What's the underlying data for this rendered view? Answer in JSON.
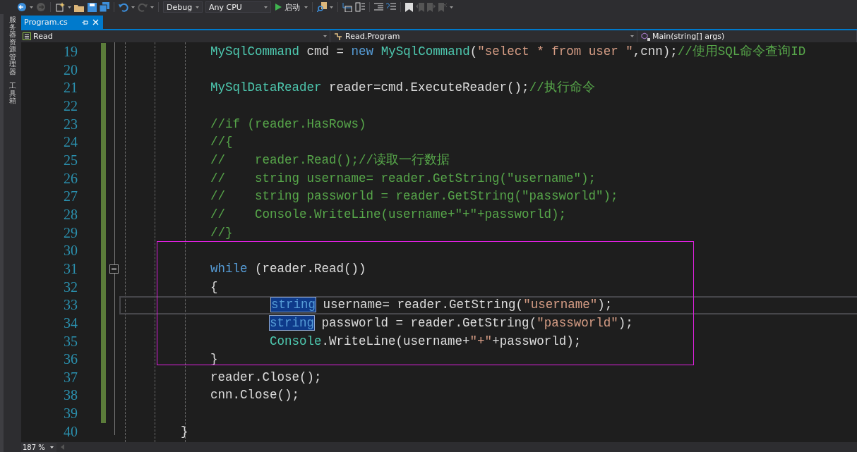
{
  "toolbar": {
    "configuration": "Debug",
    "platform": "Any CPU",
    "start_button": "启动"
  },
  "side_tabs": [
    {
      "label": "服务器资源管理器"
    },
    {
      "label": "工具箱"
    }
  ],
  "tabs": [
    {
      "label": "Program.cs",
      "selected": true
    }
  ],
  "navigation": {
    "project": "Read",
    "type": "Read.Program",
    "member": "Main(string[] args)"
  },
  "lines": [
    {
      "number": "19",
      "changed": true,
      "tokens": [
        {
          "kind": "type",
          "text": "            MySqlCommand"
        },
        {
          "kind": "plain",
          "text": " cmd = "
        },
        {
          "kind": "keyword",
          "text": "new"
        },
        {
          "kind": "type",
          "text": " MySqlCommand"
        },
        {
          "kind": "plain",
          "text": "("
        },
        {
          "kind": "string",
          "text": "\"select * from user \""
        },
        {
          "kind": "plain",
          "text": ",cnn);"
        },
        {
          "kind": "comment",
          "text": "//使用SQL命令查询ID"
        }
      ]
    },
    {
      "number": "20",
      "changed": true
    },
    {
      "number": "21",
      "changed": true,
      "tokens": [
        {
          "kind": "type",
          "text": "            MySqlDataReader"
        },
        {
          "kind": "plain",
          "text": " reader=cmd.ExecuteReader();"
        },
        {
          "kind": "comment",
          "text": "//执行命令"
        }
      ]
    },
    {
      "number": "22",
      "changed": true
    },
    {
      "number": "23",
      "changed": true,
      "tokens": [
        {
          "kind": "comment",
          "text": "            //if (reader.HasRows)"
        }
      ]
    },
    {
      "number": "24",
      "changed": true,
      "tokens": [
        {
          "kind": "comment",
          "text": "            //{"
        }
      ]
    },
    {
      "number": "25",
      "changed": true,
      "tokens": [
        {
          "kind": "comment",
          "text": "            //    reader.Read();//读取一行数据"
        }
      ]
    },
    {
      "number": "26",
      "changed": true,
      "tokens": [
        {
          "kind": "comment",
          "text": "            //    string username= reader.GetString(\"username\");"
        }
      ]
    },
    {
      "number": "27",
      "changed": true,
      "tokens": [
        {
          "kind": "comment",
          "text": "            //    string passworld = reader.GetString(\"passworld\");"
        }
      ]
    },
    {
      "number": "28",
      "changed": true,
      "tokens": [
        {
          "kind": "comment",
          "text": "            //    Console.WriteLine(username+\"+\"+passworld);"
        }
      ]
    },
    {
      "number": "29",
      "changed": true,
      "tokens": [
        {
          "kind": "comment",
          "text": "            //}"
        }
      ]
    },
    {
      "number": "30",
      "changed": true,
      "framed": true
    },
    {
      "number": "31",
      "changed": true,
      "framed": true,
      "collapsible": true,
      "tokens": [
        {
          "kind": "keyword",
          "text": "            while"
        },
        {
          "kind": "plain",
          "text": " (reader.Read())"
        }
      ]
    },
    {
      "number": "32",
      "changed": true,
      "framed": true,
      "tokens": [
        {
          "kind": "plain",
          "text": "            {"
        }
      ]
    },
    {
      "number": "33",
      "changed": true,
      "framed": true,
      "current": true,
      "tokens": [
        {
          "kind": "selection",
          "text": "                    string"
        },
        {
          "kind": "plain",
          "text": " username= reader.GetString("
        },
        {
          "kind": "string",
          "text": "\"username\""
        },
        {
          "kind": "plain",
          "text": ");"
        }
      ]
    },
    {
      "number": "34",
      "changed": true,
      "framed": true,
      "tokens": [
        {
          "kind": "selection",
          "text": "                    string"
        },
        {
          "kind": "plain",
          "text": " passworld = reader.GetString("
        },
        {
          "kind": "string",
          "text": "\"passworld\""
        },
        {
          "kind": "plain",
          "text": ");"
        }
      ]
    },
    {
      "number": "35",
      "changed": true,
      "framed": true,
      "tokens": [
        {
          "kind": "type",
          "text": "                    Console"
        },
        {
          "kind": "plain",
          "text": ".WriteLine(username+"
        },
        {
          "kind": "string",
          "text": "\"+\""
        },
        {
          "kind": "plain",
          "text": "+passworld);"
        }
      ]
    },
    {
      "number": "36",
      "changed": true,
      "framed": true,
      "tokens": [
        {
          "kind": "plain",
          "text": "            }"
        }
      ]
    },
    {
      "number": "37",
      "changed": true,
      "tokens": [
        {
          "kind": "plain",
          "text": "            reader.Close();"
        }
      ]
    },
    {
      "number": "38",
      "changed": true,
      "tokens": [
        {
          "kind": "plain",
          "text": "            cnn.Close();"
        }
      ]
    },
    {
      "number": "39",
      "changed": true
    },
    {
      "number": "40",
      "changed": false,
      "tokens": [
        {
          "kind": "plain",
          "text": "        }"
        }
      ]
    }
  ],
  "status": {
    "zoom": "187 %"
  }
}
